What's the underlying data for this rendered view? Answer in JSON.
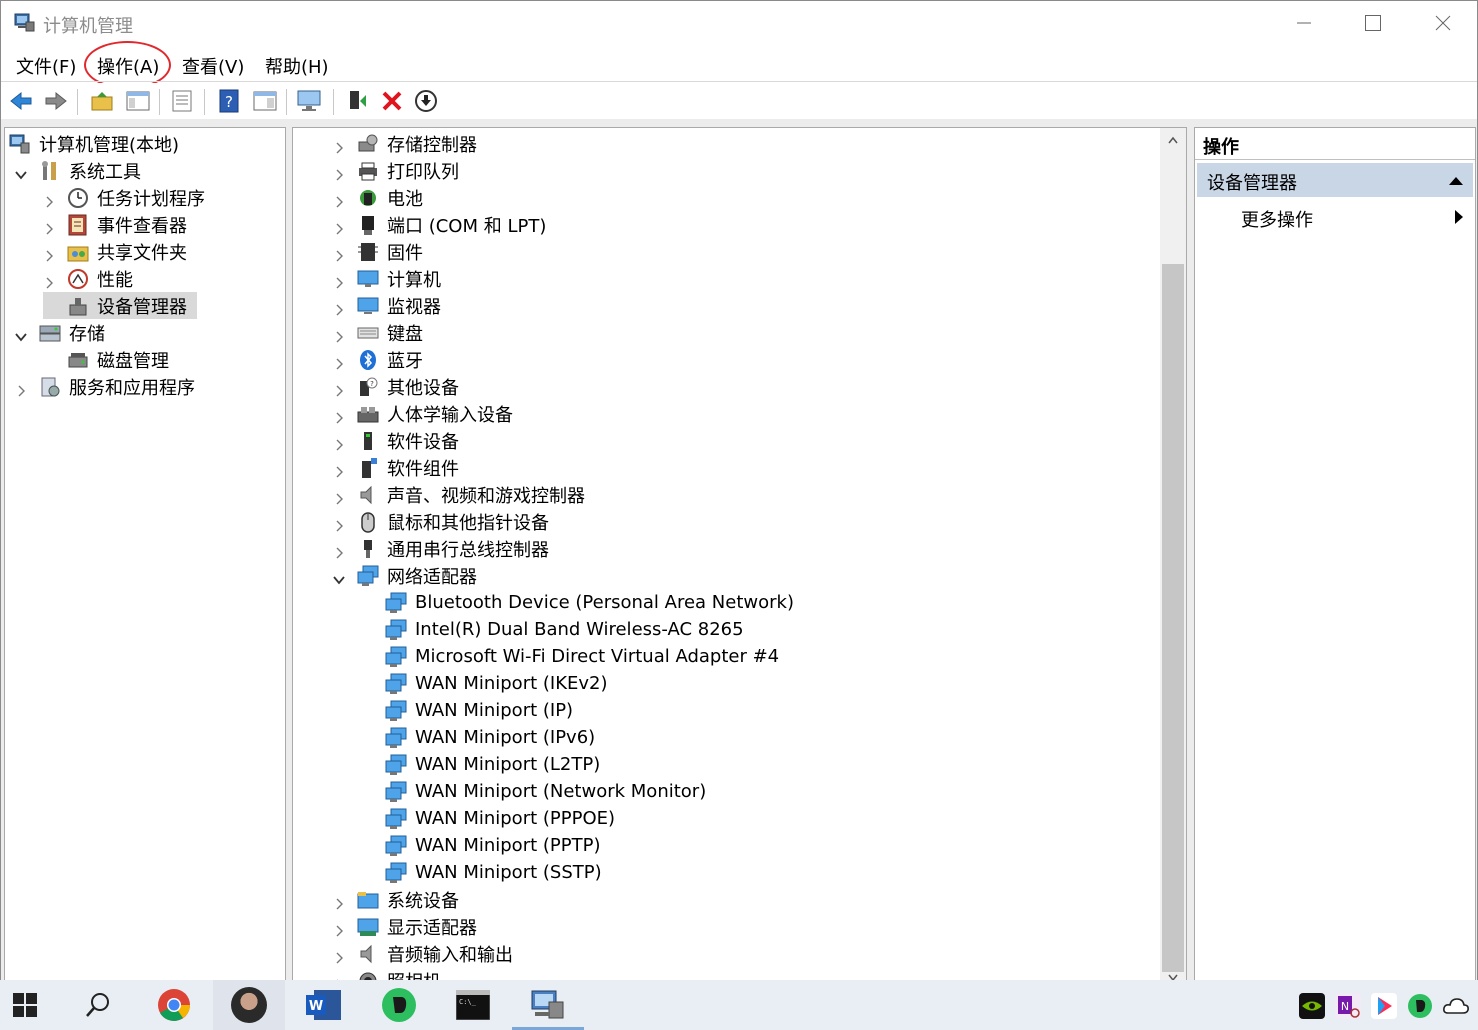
{
  "window": {
    "title": "计算机管理",
    "minimize_label": "—",
    "maximize_label": "☐",
    "close_label": "✕"
  },
  "menu": [
    {
      "label": "文件(F)"
    },
    {
      "label": "操作(A)"
    },
    {
      "label": "查看(V)"
    },
    {
      "label": "帮助(H)"
    }
  ],
  "colors": {
    "highlight_circle": "#e0282e",
    "selection": "#d9d9d9",
    "actions_section": "#c9d6e6",
    "taskbar": "#e9eef5"
  },
  "left_tree": [
    {
      "label": "计算机管理(本地)",
      "icon": "computer-management-icon",
      "expand": "none"
    },
    {
      "label": "系统工具",
      "icon": "system-tools-icon",
      "expand": "expanded"
    },
    {
      "label": "任务计划程序",
      "icon": "clock-icon",
      "expand": "collapsed"
    },
    {
      "label": "事件查看器",
      "icon": "event-viewer-icon",
      "expand": "collapsed"
    },
    {
      "label": "共享文件夹",
      "icon": "shared-folder-icon",
      "expand": "collapsed"
    },
    {
      "label": "性能",
      "icon": "performance-icon",
      "expand": "collapsed"
    },
    {
      "label": "设备管理器",
      "icon": "device-manager-icon",
      "expand": "none",
      "selected": true
    },
    {
      "label": "存储",
      "icon": "storage-icon",
      "expand": "expanded"
    },
    {
      "label": "磁盘管理",
      "icon": "disk-management-icon",
      "expand": "none"
    },
    {
      "label": "服务和应用程序",
      "icon": "services-icon",
      "expand": "collapsed"
    }
  ],
  "device_tree": [
    {
      "label": "存储控制器",
      "icon": "storage-controller-icon",
      "expand": "collapsed"
    },
    {
      "label": "打印队列",
      "icon": "printer-icon",
      "expand": "collapsed"
    },
    {
      "label": "电池",
      "icon": "battery-icon",
      "expand": "collapsed"
    },
    {
      "label": "端口 (COM 和 LPT)",
      "icon": "port-icon",
      "expand": "collapsed"
    },
    {
      "label": "固件",
      "icon": "firmware-icon",
      "expand": "collapsed"
    },
    {
      "label": "计算机",
      "icon": "computer-icon",
      "expand": "collapsed"
    },
    {
      "label": "监视器",
      "icon": "monitor-icon",
      "expand": "collapsed"
    },
    {
      "label": "键盘",
      "icon": "keyboard-icon",
      "expand": "collapsed"
    },
    {
      "label": "蓝牙",
      "icon": "bluetooth-icon",
      "expand": "collapsed"
    },
    {
      "label": "其他设备",
      "icon": "other-devices-icon",
      "expand": "collapsed"
    },
    {
      "label": "人体学输入设备",
      "icon": "hid-icon",
      "expand": "collapsed"
    },
    {
      "label": "软件设备",
      "icon": "software-device-icon",
      "expand": "collapsed"
    },
    {
      "label": "软件组件",
      "icon": "software-component-icon",
      "expand": "collapsed"
    },
    {
      "label": "声音、视频和游戏控制器",
      "icon": "sound-icon",
      "expand": "collapsed"
    },
    {
      "label": "鼠标和其他指针设备",
      "icon": "mouse-icon",
      "expand": "collapsed"
    },
    {
      "label": "通用串行总线控制器",
      "icon": "usb-icon",
      "expand": "collapsed"
    },
    {
      "label": "网络适配器",
      "icon": "network-adapter-icon",
      "expand": "expanded"
    },
    {
      "label": "Bluetooth Device (Personal Area Network)",
      "icon": "network-adapter-icon",
      "expand": "child"
    },
    {
      "label": "Intel(R) Dual Band Wireless-AC 8265",
      "icon": "network-adapter-icon",
      "expand": "child"
    },
    {
      "label": "Microsoft Wi-Fi Direct Virtual Adapter #4",
      "icon": "network-adapter-icon",
      "expand": "child"
    },
    {
      "label": "WAN Miniport (IKEv2)",
      "icon": "network-adapter-icon",
      "expand": "child"
    },
    {
      "label": "WAN Miniport (IP)",
      "icon": "network-adapter-icon",
      "expand": "child"
    },
    {
      "label": "WAN Miniport (IPv6)",
      "icon": "network-adapter-icon",
      "expand": "child"
    },
    {
      "label": "WAN Miniport (L2TP)",
      "icon": "network-adapter-icon",
      "expand": "child"
    },
    {
      "label": "WAN Miniport (Network Monitor)",
      "icon": "network-adapter-icon",
      "expand": "child"
    },
    {
      "label": "WAN Miniport (PPPOE)",
      "icon": "network-adapter-icon",
      "expand": "child"
    },
    {
      "label": "WAN Miniport (PPTP)",
      "icon": "network-adapter-icon",
      "expand": "child"
    },
    {
      "label": "WAN Miniport (SSTP)",
      "icon": "network-adapter-icon",
      "expand": "child"
    },
    {
      "label": "系统设备",
      "icon": "system-device-icon",
      "expand": "collapsed"
    },
    {
      "label": "显示适配器",
      "icon": "display-adapter-icon",
      "expand": "collapsed"
    },
    {
      "label": "音频输入和输出",
      "icon": "audio-io-icon",
      "expand": "collapsed"
    },
    {
      "label": "照相机",
      "icon": "camera-icon",
      "expand": "collapsed"
    }
  ],
  "actions": {
    "header": "操作",
    "section": "设备管理器",
    "item": "更多操作"
  },
  "taskbar": {
    "apps": [
      "start-icon",
      "search-icon",
      "chrome-icon",
      "avatar",
      "word-icon",
      "evernote-icon",
      "terminal-icon",
      "computer-management-icon"
    ],
    "tray": [
      "nvidia-icon",
      "onenote-icon",
      "youku-icon",
      "evernote-tray-icon",
      "onedrive-icon"
    ]
  }
}
